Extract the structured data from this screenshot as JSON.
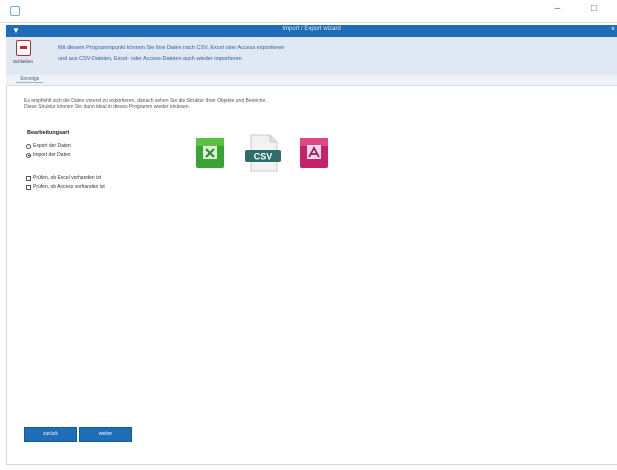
{
  "window": {
    "title": "Import / Export wizard",
    "titlebar_menu_glyph": "▼",
    "close_glyph": "×",
    "os_buttons": "– □"
  },
  "ribbon": {
    "close_label": "Schließen",
    "info_line_1": "Mit diesem Programmpunkt können Sie Ihre Daten nach CSV, Excel oder Access exportieren",
    "info_line_2": "und aus CSV-Dateien, Excel- oder Access-Dateien auch wieder importieren",
    "group_label": "Sonstige"
  },
  "description": {
    "line_1": "Es empfiehlt sich die Daten vorerst zu exportieren, danach sehen Sie die Struktur Ihrer Objekte und Bereiche.",
    "line_2": "Diese Struktur können Sie dann ideal in dieses Programm wieder einlesen."
  },
  "mode": {
    "title": "Bearbeitungsart",
    "options": [
      {
        "label": "Export der Daten",
        "selected": false
      },
      {
        "label": "Import der Daten",
        "selected": true
      }
    ]
  },
  "checks": [
    {
      "label": "Prüfen, ob Excel vorhanden ist",
      "checked": false
    },
    {
      "label": "Prüfen, ob Access vorhanden ist",
      "checked": false
    }
  ],
  "file_types": {
    "excel": {
      "icon": "excel-file-icon",
      "color": "#3aa335"
    },
    "csv": {
      "icon": "csv-file-icon",
      "text": "CSV",
      "color": "#2d6e6a"
    },
    "access": {
      "icon": "access-file-icon",
      "color": "#c5226b"
    }
  },
  "buttons": {
    "back_label": "zurück",
    "next_label": "weiter"
  },
  "colors": {
    "accent": "#1f6db6",
    "ribbon_bg": "#dfe8f3"
  }
}
